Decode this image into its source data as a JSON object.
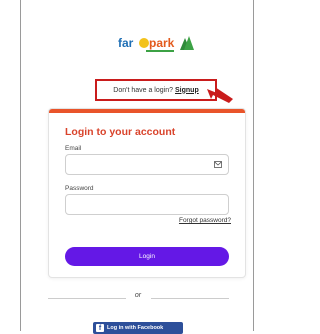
{
  "logo": {
    "text": "fargopark"
  },
  "signup_prompt": {
    "text": "Don't have a login?",
    "link": "Signup"
  },
  "card": {
    "title": "Login to your account",
    "email_label": "Email",
    "email_value": "",
    "password_label": "Password",
    "password_value": "",
    "forgot_link": "Forgot password?",
    "login_button": "Login"
  },
  "separator": {
    "text": "or"
  },
  "facebook": {
    "label": "Log in with Facebook"
  },
  "colors": {
    "accent": "#e9542a",
    "title": "#d9432b",
    "button": "#6418e6",
    "facebook": "#2d4f9a",
    "highlight": "#c91c1c"
  },
  "icons": {
    "email_field": "envelope-icon",
    "facebook": "facebook-icon"
  }
}
